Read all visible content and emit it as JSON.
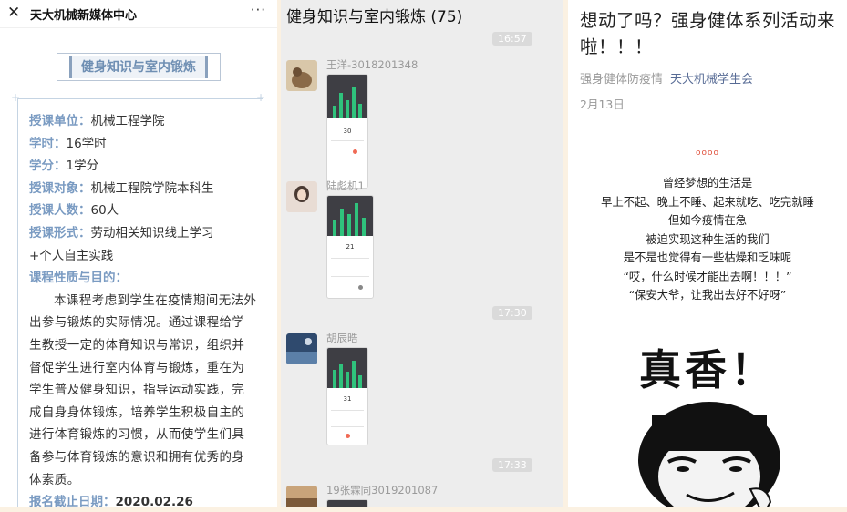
{
  "panel1": {
    "account_title": "天大机械新媒体中心",
    "more_icon": "···",
    "section_heading": "健身知识与室内锻炼",
    "fields": [
      {
        "label": "授课单位：",
        "value": "机械工程学院"
      },
      {
        "label": "学时：",
        "value": "16学时"
      },
      {
        "label": "学分：",
        "value": "1学分"
      },
      {
        "label": "授课对象：",
        "value": "机械工程院学院本科生"
      },
      {
        "label": "授课人数：",
        "value": "60人"
      },
      {
        "label": "授课形式：",
        "value": "劳动相关知识线上学习"
      }
    ],
    "form_cont": "+个人自主实践",
    "purpose_label": "课程性质与目的：",
    "purpose_text": "本课程考虑到学生在疫情期间无法外出参与锻炼的实际情况。通过课程给学生教授一定的体育知识与常识，组织并督促学生进行室内体育与锻炼，重在为学生普及健身知识，指导运动实践，完成自身身体锻炼，培养学生积极自主的进行体育锻炼的习惯，从而使学生们具备参与体育锻炼的意识和拥有优秀的身体素质。",
    "deadline_label": "报名截止日期：",
    "deadline_value": "2020.02.26"
  },
  "panel2": {
    "chat_title": "健身知识与室内锻炼 (75)",
    "times": [
      "16:57",
      "17:30",
      "17:33"
    ],
    "messages": [
      {
        "name": "王洋-3018201348",
        "num": "30"
      },
      {
        "name": "陆彪机1",
        "num": "21"
      },
      {
        "name": "胡辰晧",
        "num": "31"
      },
      {
        "name": "19张霖同3019201087",
        "num": ""
      }
    ]
  },
  "panel3": {
    "title": "想动了吗？强身健体系列活动来啦！！！",
    "byline_tag": "强身健体防疫情",
    "byline_org": "天大机械学生会",
    "date": "2月13日",
    "ornament": "oooo",
    "poem": [
      "曾经梦想的生活是",
      "早上不起、晚上不睡、起来就吃、吃完就睡",
      "但如今疫情在急",
      "被迫实现这种生活的我们",
      "是不是也觉得有一些枯燥和乏味呢",
      "“哎，什么时候才能出去啊！！！”",
      "“保安大爷，让我出去好不好呀”"
    ],
    "meme_text": "真香！"
  },
  "colors": {
    "accent_blue": "#7a9bc2",
    "chat_bg": "#ededed",
    "green": "#2fc27c",
    "link": "#576b95"
  }
}
